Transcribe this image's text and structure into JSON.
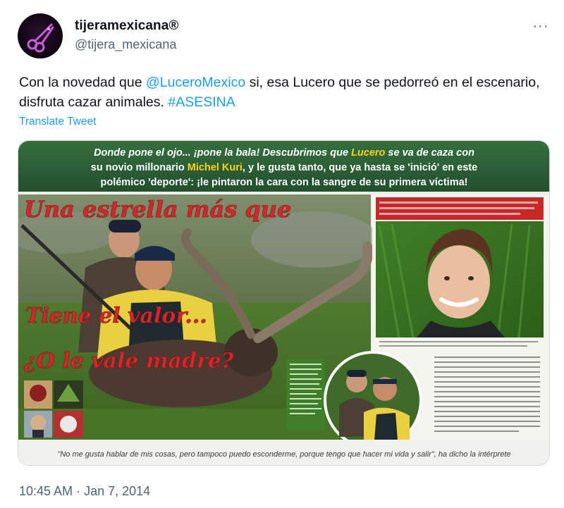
{
  "author": {
    "display_name": "tijeramexicana®",
    "handle": "@tijera_mexicana",
    "avatar_icon": "scissors-icon"
  },
  "more_icon": "more-horizontal-icon",
  "more_label": "···",
  "tweet": {
    "text_before": "Con la novedad que ",
    "mention": "@LuceroMexico",
    "text_middle": " si, esa Lucero que se pedorreó en el escenario, disfruta cazar animales. ",
    "hashtag": "#ASESINA",
    "translate_label": "Translate Tweet"
  },
  "image": {
    "header_line1_a": "Donde pone el ojo... ¡pone la bala!",
    "header_line1_b": " Descubrimos que ",
    "header_name1": "Lucero",
    "header_line1_c": " se va de caza con",
    "header_line2_a": "su novio millonario ",
    "header_name2": "Michel Kuri",
    "header_line2_b": ", y le gusta tanto, que ya hasta se 'inició' en este",
    "header_line3": "polémico 'deporte': ¡le pintaron la cara con la sangre de su primera víctima!",
    "overlay_line1": "Una estrella más que",
    "overlay_line2": "Tiene el valor...",
    "overlay_line3": "¿O le vale madre?",
    "bottom_quote": "\"No me gusta hablar de mis cosas, pero tampoco puedo esconderme, porque tengo que hacer mi vida y salir\", ha dicho la intérprete"
  },
  "meta": {
    "time": "10:45 AM",
    "separator": " · ",
    "date": "Jan 7, 2014"
  },
  "colors": {
    "link": "#1d9bf0",
    "secondary_text": "#536471",
    "header_green": "#2f6b3a",
    "overlay_red": "#d7262b",
    "name_yellow": "#ffd21a"
  }
}
